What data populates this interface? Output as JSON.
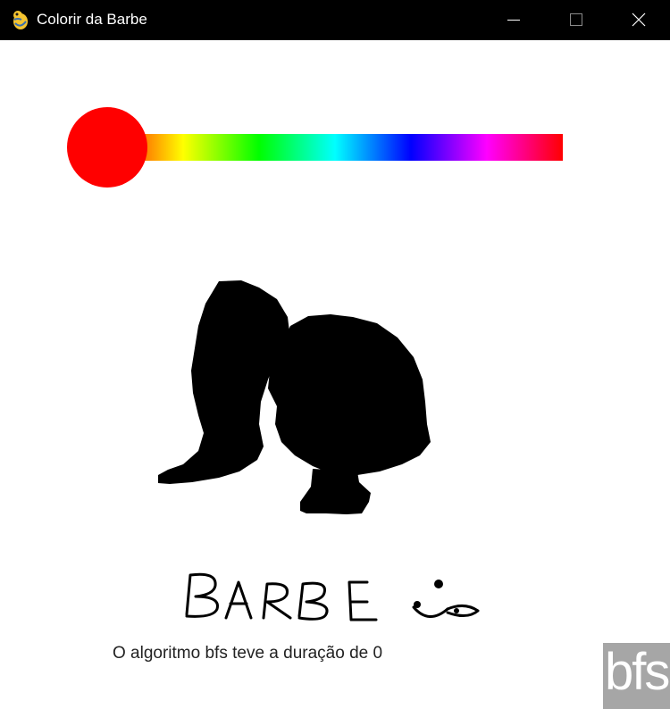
{
  "window": {
    "title": "Colorir da Barbe",
    "icon": "pygame-snake-icon",
    "controls": [
      "minimize-icon",
      "maximize-icon",
      "close-icon"
    ]
  },
  "color_picker": {
    "selected_color": "#ff0000",
    "knob_position_fraction": 0,
    "hue_stops": [
      "#ff0000",
      "#ffff00",
      "#00ff00",
      "#00ffff",
      "#0000ff",
      "#ff00ff",
      "#ff0000"
    ]
  },
  "drawing": {
    "fill_color": "#000000",
    "handwritten_text": "BARBE"
  },
  "status": {
    "message": "O algoritmo bfs teve a duração de 0"
  },
  "watermark": {
    "text": "bfs"
  }
}
